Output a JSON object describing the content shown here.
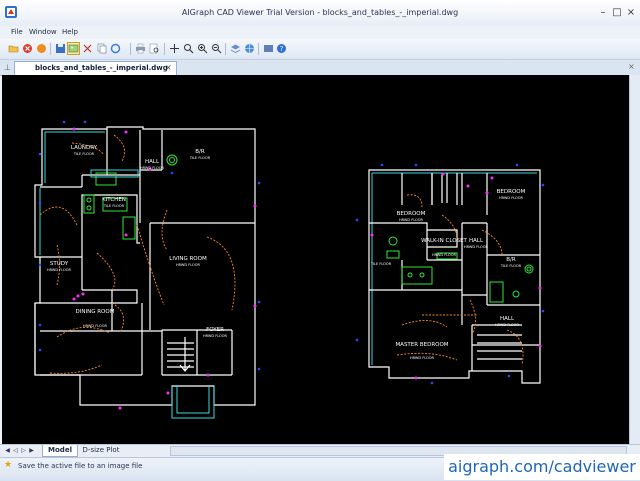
{
  "window": {
    "title": "AIGraph CAD Viewer Trial Version - blocks_and_tables_-_imperial.dwg"
  },
  "menu": {
    "items": [
      "File",
      "Window",
      "Help"
    ]
  },
  "document_tab": {
    "label": "blocks_and_tables_-_imperial.dwg"
  },
  "layout_tabs": {
    "model": "Model",
    "design_plot": "D-size Plot"
  },
  "status": {
    "text": "Save the active file to an image file"
  },
  "watermark": {
    "text": "aigraph.com/cadviewer"
  },
  "drawing": {
    "rooms_left": [
      "LAUNDRY",
      "B/R",
      "HALL",
      "KITCHEN",
      "STUDY",
      "LIVING ROOM",
      "DINING ROOM",
      "FOYER"
    ],
    "rooms_right": [
      "BEDROOM",
      "BEDROOM",
      "WALK-IN CLOSET",
      "HALL",
      "B/R",
      "MASTER BEDROOM",
      "HALL"
    ],
    "floor_labels": [
      "TILE FLOOR",
      "TILE FLOOR",
      "HRWD FLOOR",
      "TILE FLOOR",
      "HRWD FLOOR",
      "HRWD FLOOR",
      "HRWD FLOOR",
      "HRWD FLOOR",
      "HRWD FLOOR",
      "HRWD FLOOR",
      "HRWD FLOOR",
      "HRWD FLOOR",
      "HRWD FLOOR",
      "TILE FLOOR",
      "HRWD FLOOR",
      "TILE FLOOR",
      "HRWD FLOOR",
      "HRWD FLOOR"
    ]
  },
  "colors": {
    "canvas": "#000000",
    "walls": "#ffffff",
    "cyan": "#3dd6e0",
    "green": "#2ee83a",
    "orange": "#ff8a1e",
    "magenta": "#ff2cff",
    "blue": "#3046ff",
    "accent": "#1e66b6"
  },
  "icons": [
    "app-icon",
    "minimize-icon",
    "maximize-icon",
    "close-icon",
    "open-icon",
    "close-file-icon",
    "save-icon",
    "image-export-icon",
    "print-icon",
    "cut-icon",
    "copy-icon",
    "undo-icon",
    "redo-icon",
    "zoom-in-icon",
    "zoom-out-icon",
    "zoom-window-icon",
    "pan-icon",
    "layers-icon",
    "help-icon",
    "pin-icon",
    "star-icon"
  ]
}
